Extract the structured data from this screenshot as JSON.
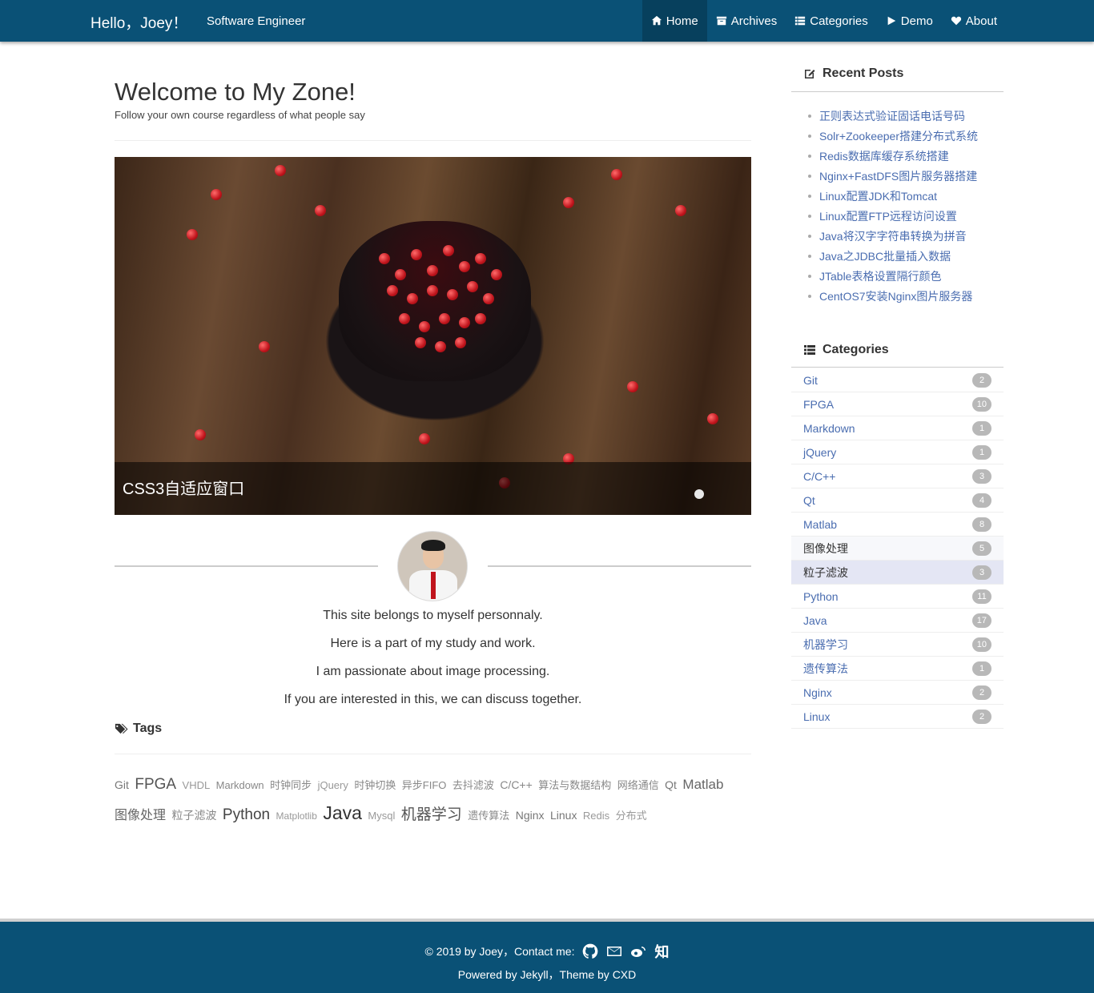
{
  "header": {
    "brand": "Hello，Joey！",
    "subtitle": "Software Engineer",
    "nav": [
      {
        "label": "Home",
        "icon": "home-icon"
      },
      {
        "label": "Archives",
        "icon": "archive-icon"
      },
      {
        "label": "Categories",
        "icon": "list-icon"
      },
      {
        "label": "Demo",
        "icon": "play-icon"
      },
      {
        "label": "About",
        "icon": "heart-icon"
      }
    ]
  },
  "main": {
    "title": "Welcome to My Zone!",
    "subtitle": "Follow your own course regardless of what people say",
    "carousel": {
      "caption": "CSS3自适应窗口"
    },
    "bio": [
      "This site belongs to myself personnaly.",
      "Here is a part of my study and work.",
      "I am passionate about image processing.",
      "If you are interested in this, we can discuss together."
    ],
    "tags_heading": "Tags",
    "tags": [
      "Git",
      "FPGA",
      "VHDL",
      "Markdown",
      "时钟同步",
      "jQuery",
      "时钟切换",
      "异步FIFO",
      "去抖滤波",
      "C/C++",
      "算法与数据结构",
      "网络通信",
      "Qt",
      "Matlab",
      "图像处理",
      "粒子滤波",
      "Python",
      "Matplotlib",
      "Java",
      "Mysql",
      "机器学习",
      "遗传算法",
      "Nginx",
      "Linux",
      "Redis",
      "分布式"
    ]
  },
  "sidebar": {
    "recent_heading": "Recent Posts",
    "recent": [
      "正则表达式验证固话电话号码",
      "Solr+Zookeeper搭建分布式系统",
      "Redis数据库缓存系统搭建",
      "Nginx+FastDFS图片服务器搭建",
      "Linux配置JDK和Tomcat",
      "Linux配置FTP远程访问设置",
      "Java将汉字字符串转换为拼音",
      "Java之JDBC批量插入数据",
      "JTable表格设置隔行颜色",
      "CentOS7安装Nginx图片服务器"
    ],
    "categories_heading": "Categories",
    "categories": [
      {
        "name": "Git",
        "count": "2"
      },
      {
        "name": "FPGA",
        "count": "10"
      },
      {
        "name": "Markdown",
        "count": "1"
      },
      {
        "name": "jQuery",
        "count": "1"
      },
      {
        "name": "C/C++",
        "count": "3"
      },
      {
        "name": "Qt",
        "count": "4"
      },
      {
        "name": "Matlab",
        "count": "8"
      },
      {
        "name": "图像处理",
        "count": "5"
      },
      {
        "name": "粒子滤波",
        "count": "3"
      },
      {
        "name": "Python",
        "count": "11"
      },
      {
        "name": "Java",
        "count": "17"
      },
      {
        "name": "机器学习",
        "count": "10"
      },
      {
        "name": "遗传算法",
        "count": "1"
      },
      {
        "name": "Nginx",
        "count": "2"
      },
      {
        "name": "Linux",
        "count": "2"
      }
    ]
  },
  "footer": {
    "line1": "© 2019 by Joey，Contact me:",
    "zhihu": "知",
    "line2": "Powered by Jekyll，Theme by CXD"
  },
  "colors": {
    "header_bg": "#0a5176",
    "link": "#4a6db0",
    "badge": "#b8b8b8",
    "hover_row": "#e4e6f4"
  }
}
